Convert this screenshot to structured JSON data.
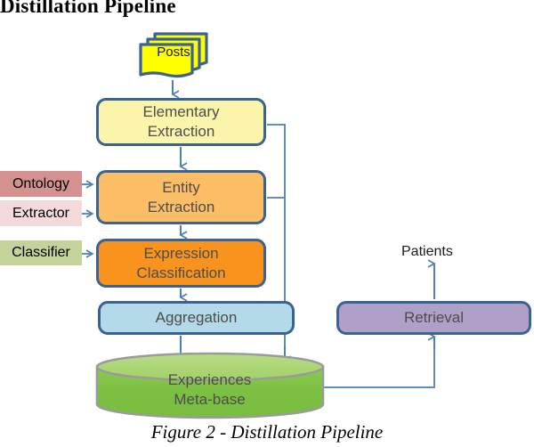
{
  "figure": {
    "title": "Distillation Pipeline",
    "caption": "Figure 2 - Distillation Pipeline"
  },
  "source": {
    "label": "Posts",
    "icon": "document-stack-icon",
    "fill": "#ffff00",
    "border": "#3a6392"
  },
  "pipeline": {
    "stages": [
      {
        "id": "elementary",
        "label_line1": "Elementary",
        "label_line2": "Extraction",
        "fill": "#fbf4ab"
      },
      {
        "id": "entity",
        "label_line1": "Entity",
        "label_line2": "Extraction",
        "fill": "#fbbe67"
      },
      {
        "id": "expression",
        "label_line1": "Expression",
        "label_line2": "Classification",
        "fill": "#f8931d"
      },
      {
        "id": "aggregation",
        "label_line1": "Aggregation",
        "label_line2": "",
        "fill": "#b4d9e8"
      }
    ]
  },
  "resources": [
    {
      "id": "ontology",
      "label": "Ontology",
      "fill": "#d59090"
    },
    {
      "id": "extractor",
      "label": "Extractor",
      "fill": "#f2dada"
    },
    {
      "id": "classifier",
      "label": "Classifier",
      "fill": "#c3d39a"
    }
  ],
  "store": {
    "label_line1": "Experiences",
    "label_line2": "Meta-base",
    "icon": "database-cylinder-icon",
    "fill": "#7cc043",
    "top_fill": "#a6d46e",
    "border": "#9b9b9b"
  },
  "output": {
    "retrieval_label": "Retrieval",
    "retrieval_fill": "#b0a0c8",
    "consumer_label": "Patients"
  },
  "colors": {
    "box_border": "#3a6392",
    "connector": "#4f7fb3",
    "box_text": "#4d4d4d",
    "plain_text": "#1a1a1a"
  }
}
